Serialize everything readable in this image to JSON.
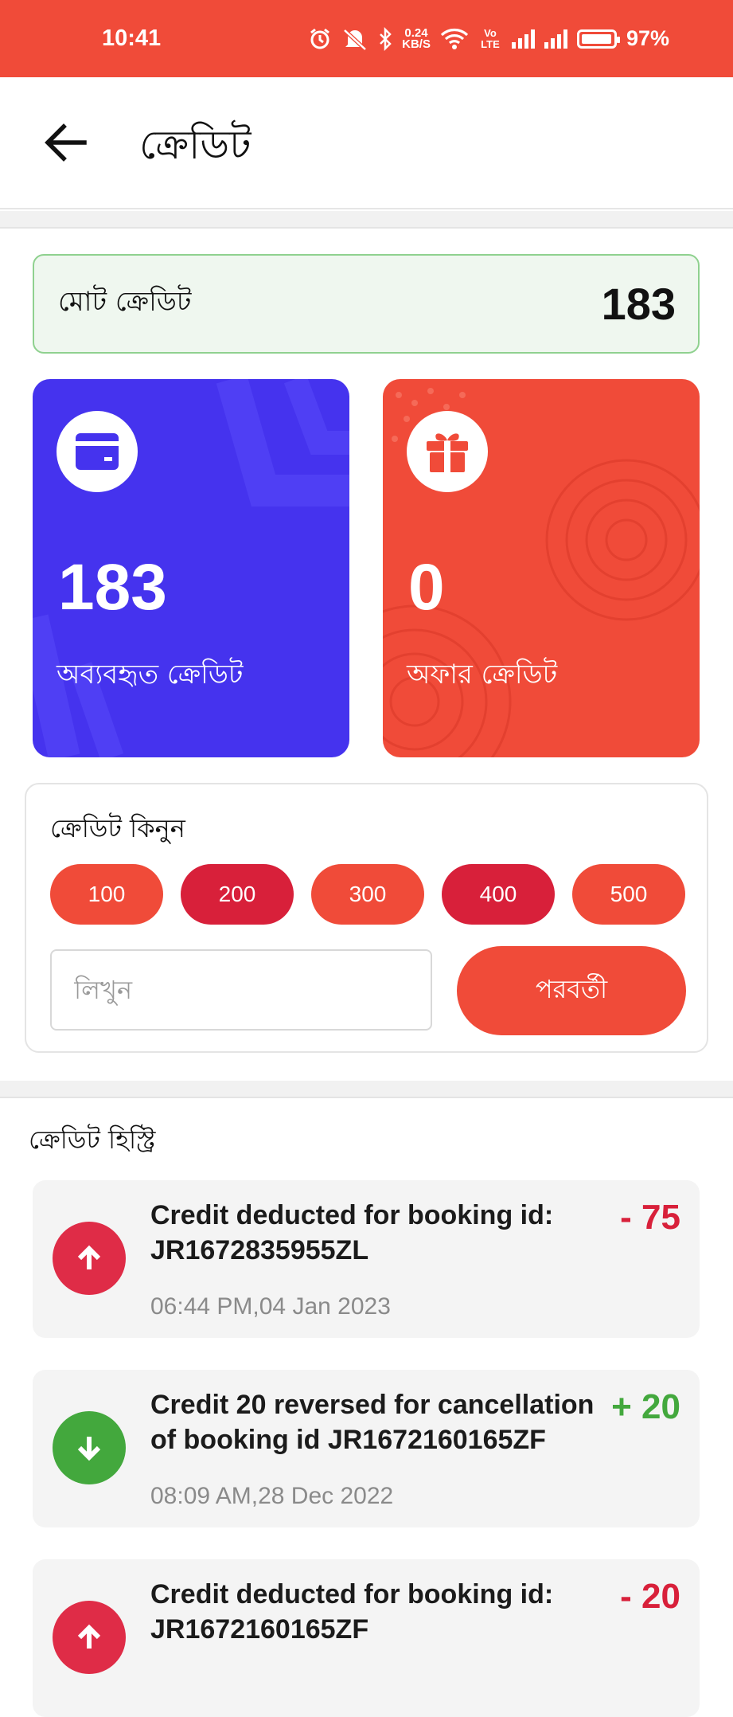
{
  "status_bar": {
    "time": "10:41",
    "net_speed": "0.24",
    "net_unit": "KB/S",
    "volte": "Vo LTE",
    "battery": "97%"
  },
  "header": {
    "title": "ক্রেডিট"
  },
  "total": {
    "label": "মোট ক্রেডিট",
    "value": "183"
  },
  "cards": {
    "unused": {
      "value": "183",
      "label": "অব্যবহৃত ক্রেডিট"
    },
    "offer": {
      "value": "0",
      "label": "অফার ক্রেডিট"
    }
  },
  "buy": {
    "title": "ক্রেডিট কিনুন",
    "amounts": [
      "100",
      "200",
      "300",
      "400",
      "500"
    ],
    "input_placeholder": "লিখুন",
    "next_label": "পরবর্তী"
  },
  "history": {
    "title": "ক্রেডিট হিস্ট্রি",
    "items": [
      {
        "text": "Credit deducted for booking id: JR1672835955ZL",
        "date": "06:44 PM,04 Jan 2023",
        "amount": "- 75",
        "type": "debit"
      },
      {
        "text": "Credit 20 reversed for cancellation of booking id JR1672160165ZF",
        "date": "08:09 AM,28 Dec 2022",
        "amount": "+ 20",
        "type": "credit"
      },
      {
        "text": "Credit deducted for booking id: JR1672160165ZF",
        "date": "",
        "amount": "- 20",
        "type": "debit"
      }
    ]
  },
  "colors": {
    "accent_red": "#f04b39",
    "dark_red": "#d8203a",
    "blue": "#4533ee",
    "green": "#43a83d",
    "debit": "#d8203a"
  }
}
